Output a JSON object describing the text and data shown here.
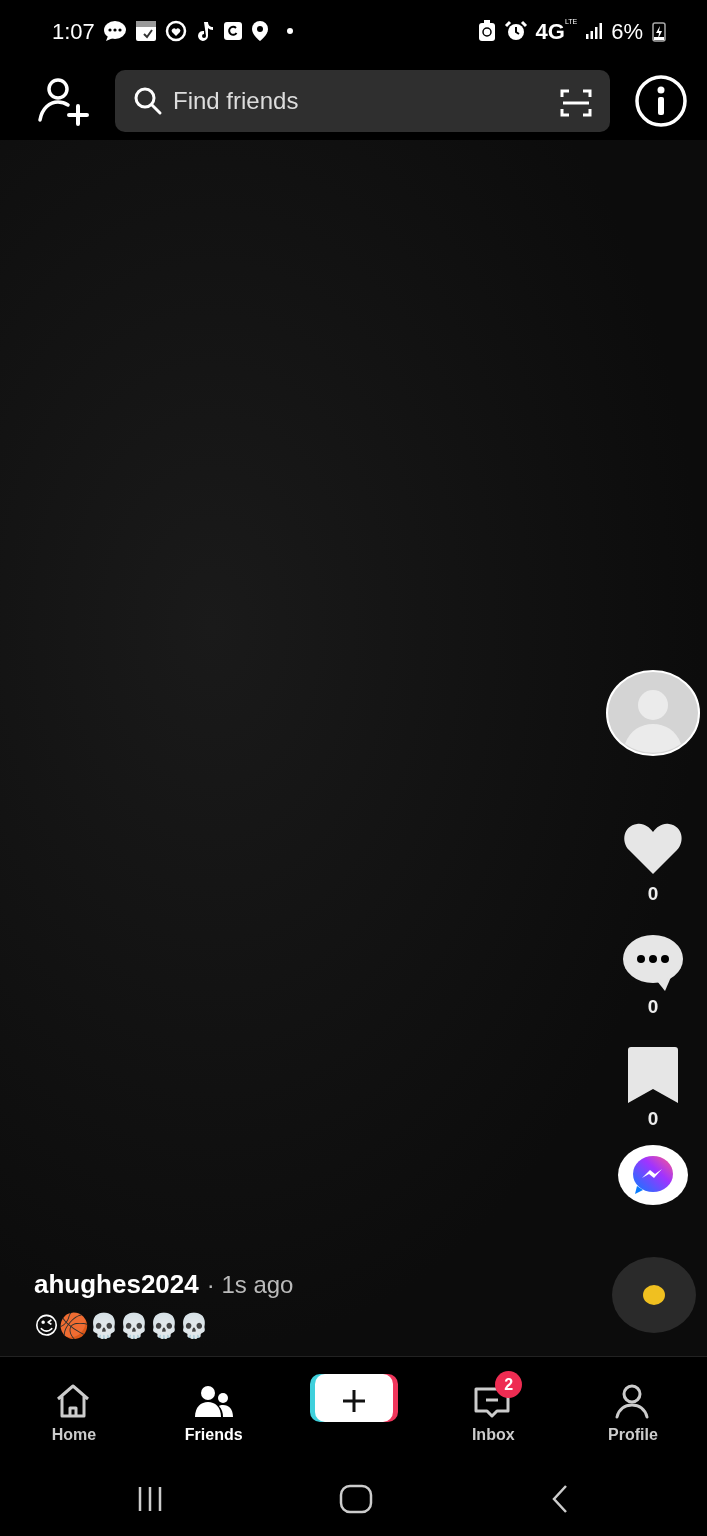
{
  "status_bar": {
    "time": "1:07",
    "network": "4G",
    "network_sub": "LTE",
    "battery": "6%",
    "charging": true
  },
  "top_bar": {
    "search": {
      "placeholder": "Find friends"
    }
  },
  "actions": [
    {
      "kind": "like",
      "count": "0"
    },
    {
      "kind": "comment",
      "count": "0"
    },
    {
      "kind": "save",
      "count": "0"
    }
  ],
  "post": {
    "username": "ahughes2024",
    "time": "· 1s ago",
    "caption": "😉🏀💀💀💀💀"
  },
  "tabs": [
    {
      "kind": "home",
      "label": "Home",
      "selected": false
    },
    {
      "kind": "friends",
      "label": "Friends",
      "selected": true
    },
    {
      "kind": "create",
      "selected": false
    },
    {
      "kind": "inbox",
      "label": "Inbox",
      "selected": false,
      "badge": "2"
    },
    {
      "kind": "profile",
      "label": "Profile",
      "selected": false
    }
  ]
}
